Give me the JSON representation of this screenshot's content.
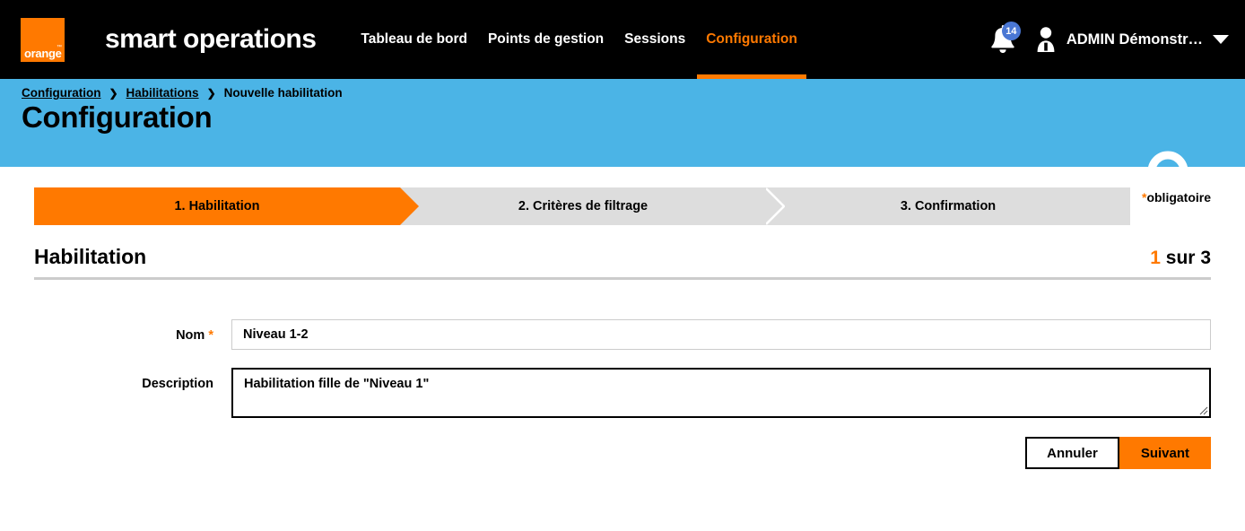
{
  "header": {
    "logo_word": "orange",
    "logo_tm": "™",
    "brand": "smart operations",
    "nav": [
      {
        "label": "Tableau de bord",
        "active": false
      },
      {
        "label": "Points de gestion",
        "active": false
      },
      {
        "label": "Sessions",
        "active": false
      },
      {
        "label": "Configuration",
        "active": true
      }
    ],
    "notifications": {
      "icon": "bell-icon",
      "count": "14",
      "badge_color": "#4a77d4"
    },
    "user": {
      "icon": "user-avatar-icon",
      "name": "ADMIN Démonstr…",
      "caret_icon": "chevron-down-icon"
    }
  },
  "banner": {
    "breadcrumb": [
      {
        "label": "Configuration",
        "link": true
      },
      {
        "label": "Habilitations",
        "link": true
      },
      {
        "label": "Nouvelle habilitation",
        "link": false
      }
    ],
    "separator": "❯",
    "title": "Configuration",
    "background_color": "#4bb4e6"
  },
  "wizard": {
    "steps": [
      {
        "label": "1. Habilitation",
        "state": "active"
      },
      {
        "label": "2. Critères de filtrage",
        "state": "inactive"
      },
      {
        "label": "3. Confirmation",
        "state": "inactive"
      }
    ],
    "required_note_star": "*",
    "required_note": "obligatoire",
    "active_color": "#ff7900",
    "inactive_color": "#dddddd"
  },
  "section": {
    "title": "Habilitation",
    "count_current": "1",
    "count_rest": " sur 3"
  },
  "form": {
    "nom": {
      "label": "Nom",
      "required_star": "*",
      "value": "Niveau 1-2",
      "placeholder": ""
    },
    "description": {
      "label": "Description",
      "value": "Habilitation fille de \"Niveau 1\"",
      "placeholder": ""
    }
  },
  "actions": {
    "cancel_label": "Annuler",
    "next_label": "Suivant"
  }
}
